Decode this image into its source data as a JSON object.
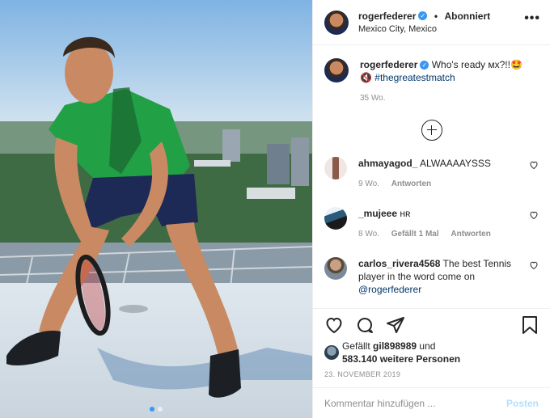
{
  "header": {
    "username": "rogerfederer",
    "separator": "•",
    "follow_label": "Abonniert",
    "location": "Mexico City, Mexico",
    "more_label": "•••"
  },
  "caption": {
    "username": "rogerfederer",
    "text": "Who's ready ᴍx?!!🤩",
    "hashtag_icon": "🔇",
    "hashtag": "#thegreatestmatch",
    "time": "35 Wo."
  },
  "comments": [
    {
      "username": "ahmayagod_",
      "text": "ALWAAAAYSSS",
      "time": "9 Wo.",
      "likes": "",
      "reply": "Antworten"
    },
    {
      "username": "_mujeee",
      "text": "ʜʀ",
      "time": "8 Wo.",
      "likes": "Gefällt 1 Mal",
      "reply": "Antworten"
    },
    {
      "username": "carlos_rivera4568",
      "text": "The best Tennis player in the word come on",
      "mention": "@rogerfederer",
      "time": "",
      "likes": "",
      "reply": ""
    }
  ],
  "likes": {
    "prefix": "Gefällt",
    "liker": "gil898989",
    "suffix": "und",
    "others": "583.140 weitere Personen"
  },
  "date": "23. NOVEMBER 2019",
  "add_comment": {
    "placeholder": "Kommentar hinzufügen ...",
    "post_label": "Posten"
  },
  "colors": {
    "verified": "#3897f0",
    "link": "#00376b",
    "muted": "#8e8e8e",
    "post_disabled": "#b2dffc"
  }
}
